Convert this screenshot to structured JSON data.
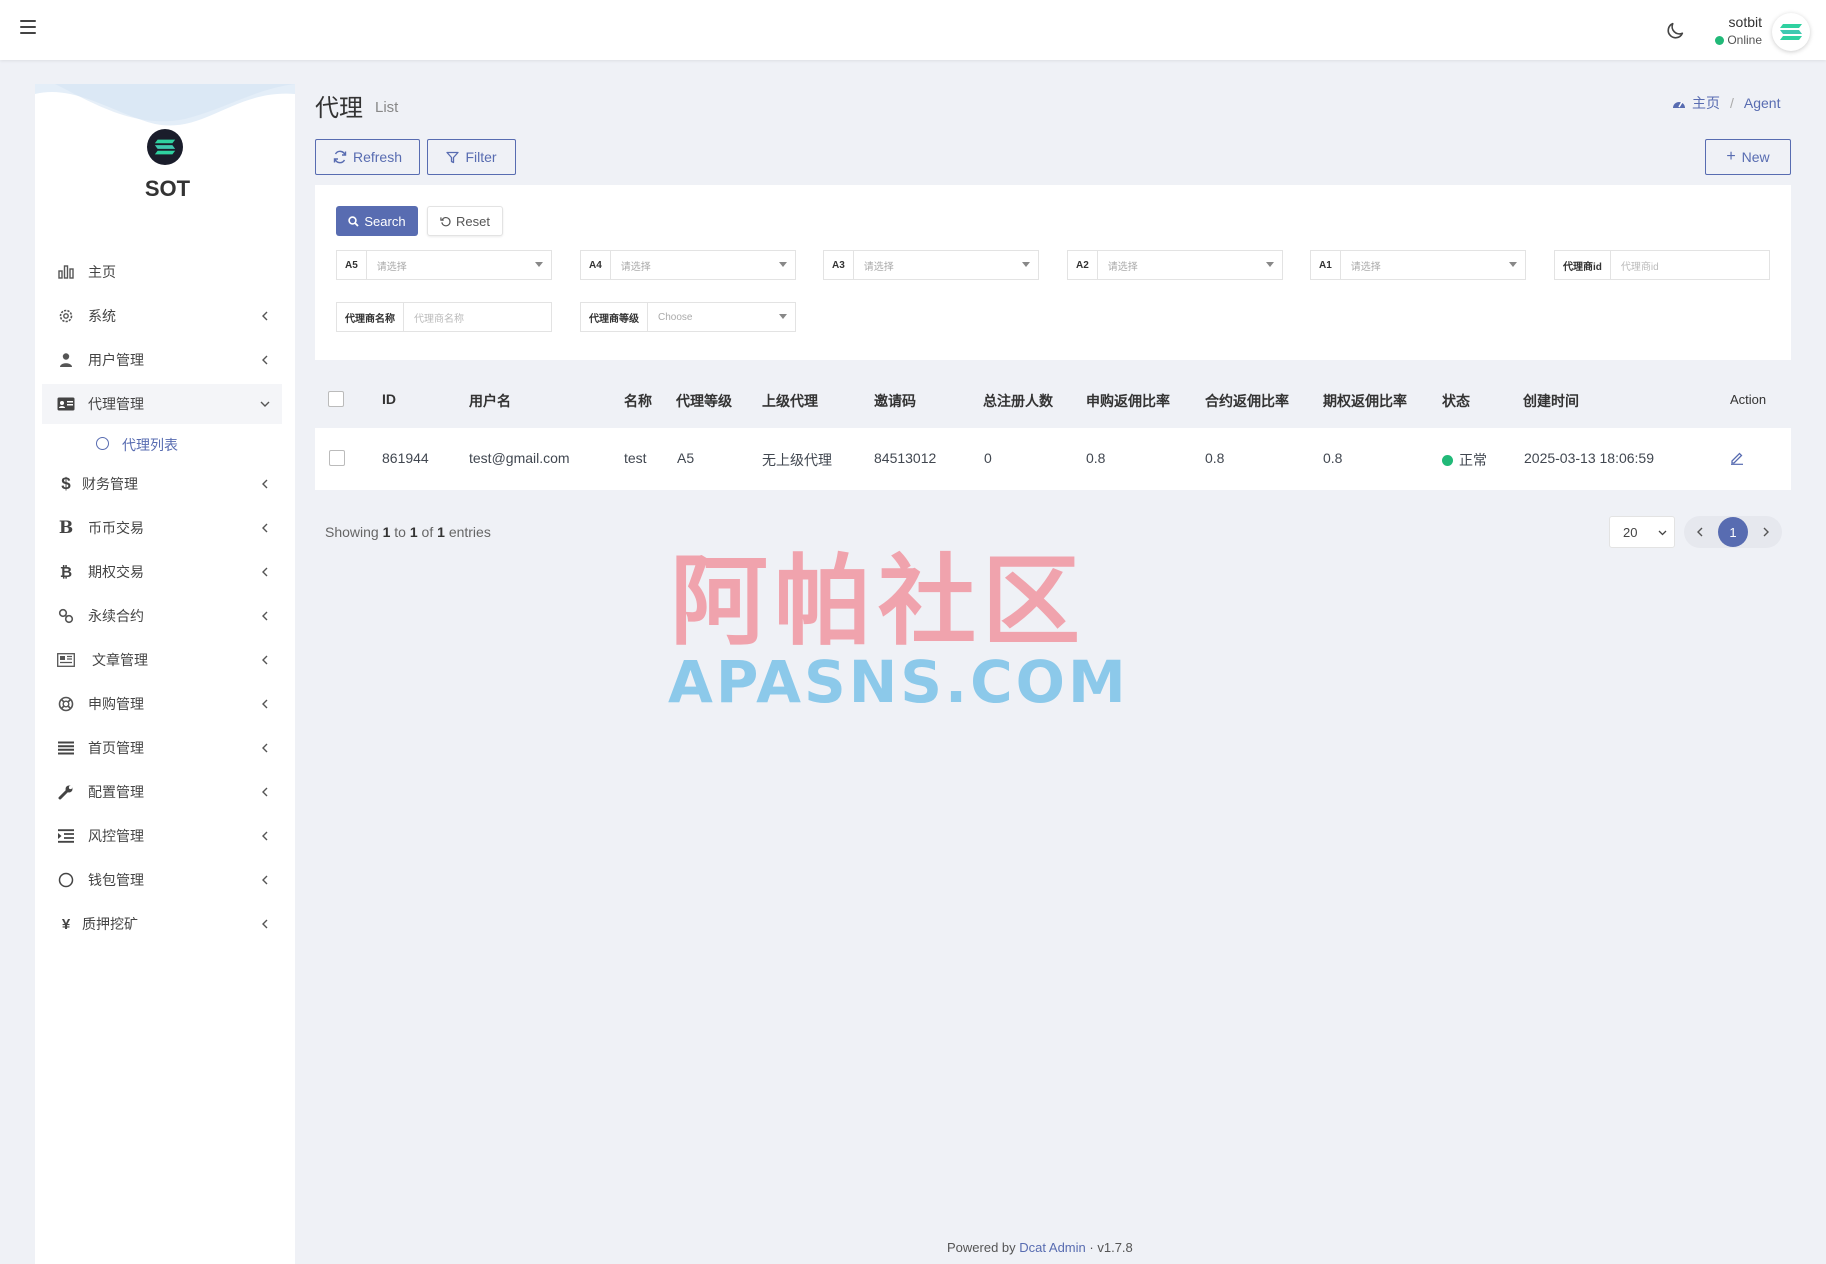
{
  "topbar": {
    "user_name": "sotbit",
    "user_status": "Online"
  },
  "sidebar": {
    "brand": "SOT",
    "items": [
      {
        "label": "主页",
        "icon": "bar-chart-icon"
      },
      {
        "label": "系统",
        "icon": "gear-icon"
      },
      {
        "label": "用户管理",
        "icon": "users-icon"
      },
      {
        "label": "代理管理",
        "icon": "id-card-icon"
      },
      {
        "label": "财务管理",
        "icon": "dollar-icon"
      },
      {
        "label": "币币交易",
        "icon": "b-icon"
      },
      {
        "label": "期权交易",
        "icon": "bitcoin-icon"
      },
      {
        "label": "永续合约",
        "icon": "link-icon"
      },
      {
        "label": "文章管理",
        "icon": "newspaper-icon"
      },
      {
        "label": "申购管理",
        "icon": "life-ring-icon"
      },
      {
        "label": "首页管理",
        "icon": "list-icon"
      },
      {
        "label": "配置管理",
        "icon": "wrench-icon"
      },
      {
        "label": "风控管理",
        "icon": "indent-icon"
      },
      {
        "label": "钱包管理",
        "icon": "circle-icon"
      },
      {
        "label": "质押挖矿",
        "icon": "yen-icon"
      }
    ],
    "sub_item": "代理列表"
  },
  "header": {
    "title": "代理",
    "subtitle": "List",
    "breadcrumb_home": "主页",
    "breadcrumb_sep": "/",
    "breadcrumb_current": "Agent"
  },
  "toolbar": {
    "refresh": "Refresh",
    "filter": "Filter",
    "new": "New"
  },
  "filter": {
    "search": "Search",
    "reset": "Reset",
    "fields": [
      {
        "label": "A5",
        "placeholder": "请选择"
      },
      {
        "label": "A4",
        "placeholder": "请选择"
      },
      {
        "label": "A3",
        "placeholder": "请选择"
      },
      {
        "label": "A2",
        "placeholder": "请选择"
      },
      {
        "label": "A1",
        "placeholder": "请选择"
      },
      {
        "label": "代理商id",
        "placeholder": "代理商id"
      },
      {
        "label": "代理商名称",
        "placeholder": "代理商名称"
      },
      {
        "label": "代理商等级",
        "placeholder": "Choose"
      }
    ]
  },
  "table": {
    "columns": [
      "ID",
      "用户名",
      "名称",
      "代理等级",
      "上级代理",
      "邀请码",
      "总注册人数",
      "申购返佣比率",
      "合约返佣比率",
      "期权返佣比率",
      "状态",
      "创建时间",
      "Action"
    ],
    "rows": [
      [
        "861944",
        "test@gmail.com",
        "test",
        "A5",
        "无上级代理",
        "84513012",
        "0",
        "0.8",
        "0.8",
        "0.8",
        "正常",
        "2025-03-13 18:06:59"
      ]
    ]
  },
  "pagination": {
    "showing_prefix": "Showing",
    "from": "1",
    "to_word": "to",
    "to": "1",
    "of_word": "of",
    "total": "1",
    "entries_word": "entries",
    "per_page": "20",
    "current_page": "1"
  },
  "watermark": {
    "cn": "阿帕社区",
    "en": "APASNS.COM"
  },
  "footer": {
    "prefix": "Powered by",
    "link": "Dcat Admin",
    "sep": "·",
    "version": "v1.7.8"
  },
  "colors": {
    "primary": "#586cb1",
    "success": "#21b978",
    "background": "#eff1f6"
  }
}
